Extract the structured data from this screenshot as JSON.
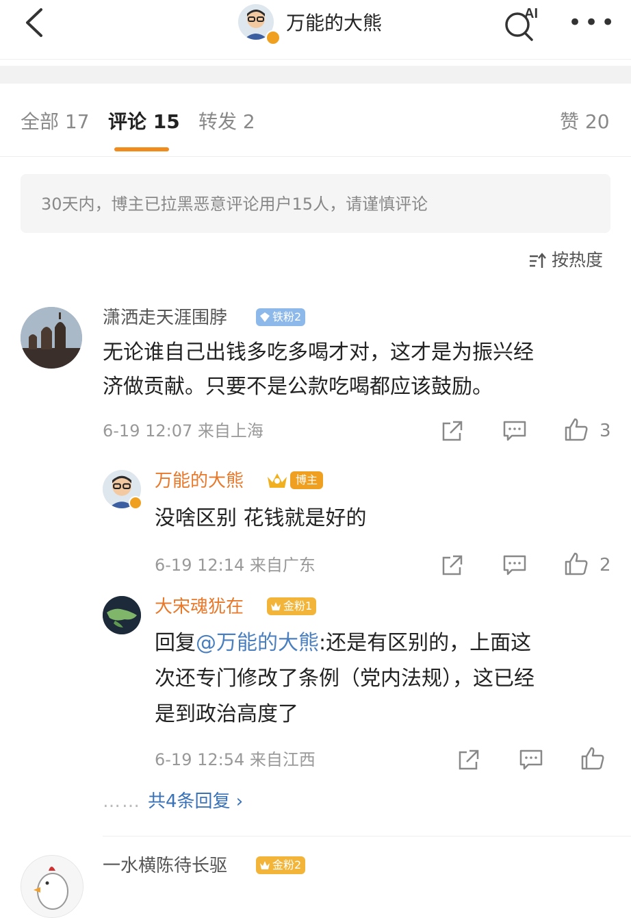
{
  "header": {
    "title": "万能的大熊",
    "ai_label": "AI",
    "more_label": "•••"
  },
  "tabs": [
    {
      "label": "全部 17"
    },
    {
      "label": "评论 15"
    },
    {
      "label": "转发 2"
    },
    {
      "label": "赞 20"
    }
  ],
  "notice": "30天内，博主已拉黑恶意评论用户15人，请谨慎评论",
  "sort": {
    "label": "按热度"
  },
  "colors": {
    "accent": "#f08c1e",
    "link": "#3a72b8",
    "vip_name": "#e8782a"
  },
  "comments": [
    {
      "user": "潇洒走天涯围脖",
      "badge": "铁粉2",
      "text_line1": "无论谁自己出钱多吃多喝才对，这才是为振兴经",
      "text_line2": "济做贡献。只要不是公款吃喝都应该鼓励。",
      "meta": "6-19 12:07  来自上海",
      "likes": "3"
    },
    {
      "user": "万能的大熊",
      "badge": "博主",
      "text": "没啥区别 花钱就是好的",
      "meta": "6-19 12:14  来自广东",
      "likes": "2"
    },
    {
      "user": "大宋魂犹在",
      "badge": "金粉1",
      "reply_prefix": "回复",
      "mention": "@万能的大熊",
      "text_line1_rest": ":还是有区别的，上面这",
      "text_line2": "次还专门修改了条例（党内法规），这已经",
      "text_line3": "是到政治高度了",
      "meta": "6-19 12:54  来自江西"
    },
    {
      "user": "一水横陈待长驱",
      "badge": "金粉2"
    }
  ],
  "more_replies": {
    "dots": "……",
    "label": "共4条回复 ›"
  }
}
